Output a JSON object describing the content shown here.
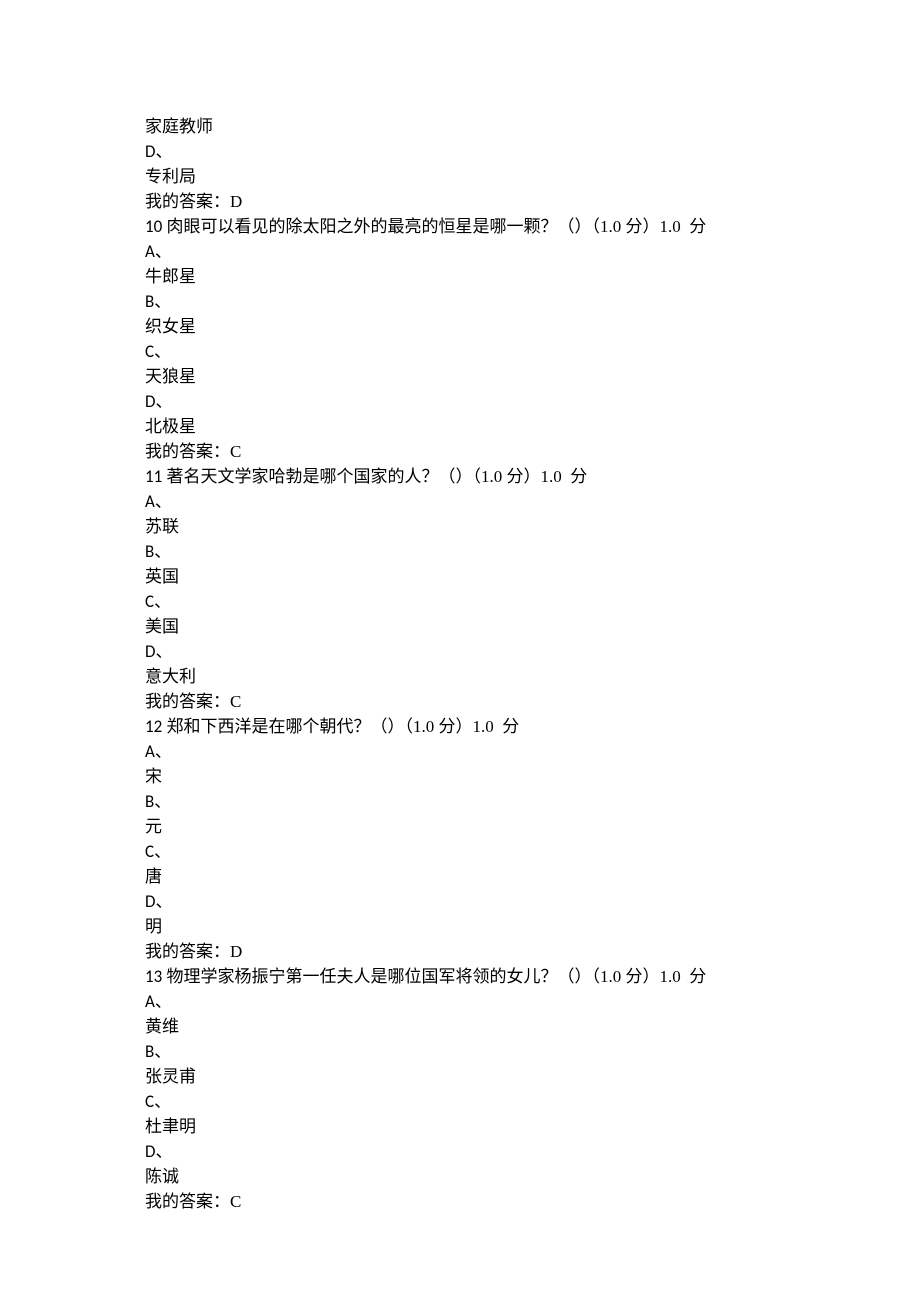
{
  "pre": {
    "c_text": "家庭教师",
    "d_marker": "D、",
    "d_text": "专利局",
    "answer": "我的答案：D"
  },
  "questions": [
    {
      "num": "10",
      "stem": " 肉眼可以看见的除太阳之外的最亮的恒星是哪一颗？（）（1.0 分）1.0  分",
      "opts": [
        "牛郎星",
        "织女星",
        "天狼星",
        "北极星"
      ],
      "answer": "我的答案：C"
    },
    {
      "num": "11",
      "stem": " 著名天文学家哈勃是哪个国家的人？（）（1.0 分）1.0  分",
      "opts": [
        "苏联",
        "英国",
        "美国",
        "意大利"
      ],
      "answer": "我的答案：C"
    },
    {
      "num": "12",
      "stem": " 郑和下西洋是在哪个朝代？（）（1.0 分）1.0  分",
      "opts": [
        "宋",
        "元",
        "唐",
        "明"
      ],
      "answer": "我的答案：D"
    },
    {
      "num": "13",
      "stem": " 物理学家杨振宁第一任夫人是哪位国军将领的女儿？（）（1.0 分）1.0  分",
      "opts": [
        "黄维",
        "张灵甫",
        "杜聿明",
        "陈诚"
      ],
      "answer": "我的答案：C"
    }
  ],
  "markers": [
    "A、",
    "B、",
    "C、",
    "D、"
  ]
}
